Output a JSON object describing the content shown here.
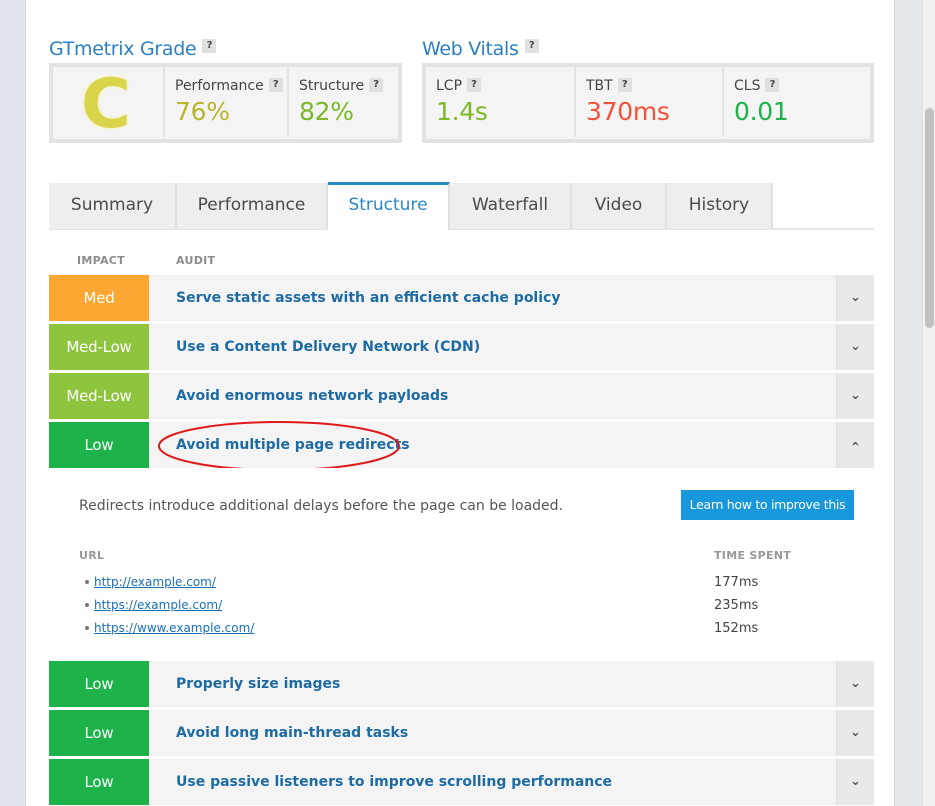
{
  "grade": {
    "title": "GTmetrix Grade",
    "help": "?",
    "letter": "C",
    "performance_label": "Performance",
    "performance_value": "76%",
    "structure_label": "Structure",
    "structure_value": "82%"
  },
  "vitals": {
    "title": "Web Vitals",
    "help": "?",
    "lcp_label": "LCP",
    "lcp_value": "1.4s",
    "tbt_label": "TBT",
    "tbt_value": "370ms",
    "cls_label": "CLS",
    "cls_value": "0.01"
  },
  "colors": {
    "grade_c": "#d9d44a",
    "good": "#7cb827",
    "poor": "#f0533a",
    "accent": "#2b86c5",
    "impact_med": "#fba732",
    "impact_medlow": "#8fc43e",
    "impact_low": "#1eb24a"
  },
  "tabs": [
    "Summary",
    "Performance",
    "Structure",
    "Waterfall",
    "Video",
    "History"
  ],
  "active_tab": "Structure",
  "columns": {
    "impact": "IMPACT",
    "audit": "AUDIT"
  },
  "audits": [
    {
      "impact": "Med",
      "title": "Serve static assets with an efficient cache policy",
      "chevron": "down"
    },
    {
      "impact": "Med-Low",
      "title": "Use a Content Delivery Network (CDN)",
      "chevron": "down"
    },
    {
      "impact": "Med-Low",
      "title": "Avoid enormous network payloads",
      "chevron": "down"
    },
    {
      "impact": "Low",
      "title": "Avoid multiple page redirects",
      "chevron": "up"
    },
    {
      "impact": "Low",
      "title": "Properly size images",
      "chevron": "down"
    },
    {
      "impact": "Low",
      "title": "Avoid long main-thread tasks",
      "chevron": "down"
    },
    {
      "impact": "Low",
      "title": "Use passive listeners to improve scrolling performance",
      "chevron": "down"
    }
  ],
  "expanded": {
    "description": "Redirects introduce additional delays before the page can be loaded.",
    "learn_button": "Learn how to improve this",
    "url_header": "URL",
    "time_header": "TIME SPENT",
    "rows": [
      {
        "url": "http://example.com/",
        "time": "177ms"
      },
      {
        "url": "https://example.com/",
        "time": "235ms"
      },
      {
        "url": "https://www.example.com/",
        "time": "152ms"
      }
    ]
  }
}
